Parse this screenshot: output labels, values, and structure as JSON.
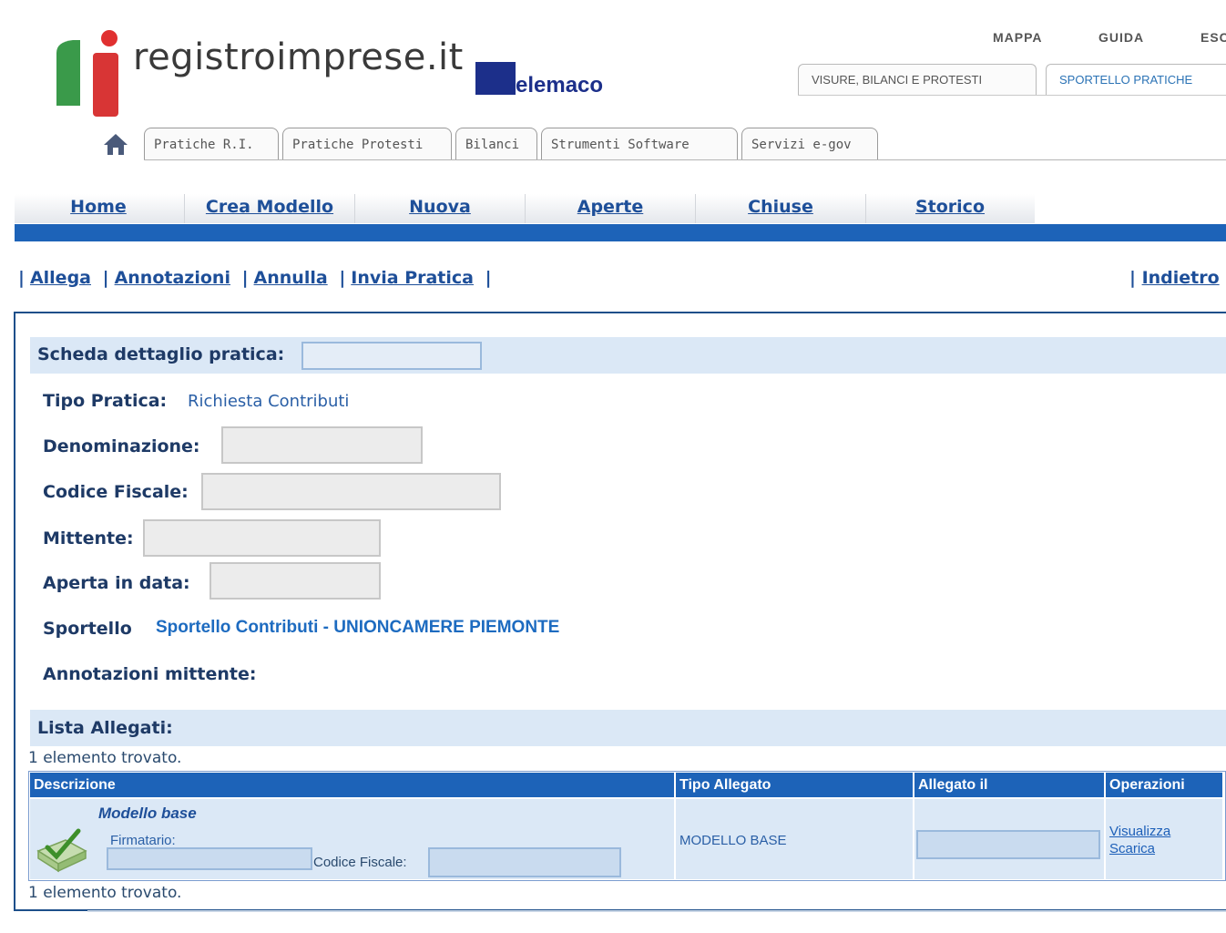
{
  "header": {
    "logo_text": "registroimprese.it",
    "telemaco_text": "elemaco",
    "top_links": [
      "MAPPA",
      "GUIDA",
      "ESCI"
    ],
    "main_tabs": [
      "VISURE, BILANCI E PROTESTI",
      "SPORTELLO PRATICHE"
    ],
    "sub_tabs": [
      "Pratiche R.I.",
      "Pratiche Protesti",
      "Bilanci",
      "Strumenti Software",
      "Servizi e-gov"
    ]
  },
  "nav": {
    "items": [
      "Home",
      "Crea Modello",
      "Nuova",
      "Aperte",
      "Chiuse",
      "Storico"
    ]
  },
  "actions": {
    "items": [
      "Allega",
      "Annotazioni",
      "Annulla",
      "Invia Pratica"
    ],
    "back": "Indietro"
  },
  "detail": {
    "title": "Scheda dettaglio pratica:",
    "tipo_label": "Tipo Pratica:",
    "tipo_value": "Richiesta Contributi",
    "denominazione_label": "Denominazione:",
    "codice_fiscale_label": "Codice Fiscale:",
    "mittente_label": "Mittente:",
    "aperta_label": "Aperta in data:",
    "sportello_label": "Sportello",
    "sportello_value": "Sportello Contributi  - UNIONCAMERE PIEMONTE",
    "annotazioni_label": "Annotazioni mittente:"
  },
  "allegati": {
    "title": "Lista Allegati:",
    "count_text": "1 elemento trovato.",
    "columns": [
      "Descrizione",
      "Tipo Allegato",
      "Allegato il",
      "Operazioni"
    ],
    "rows": [
      {
        "name": "Modello base",
        "firmatario_label": "Firmatario:",
        "codice_fiscale_label": "Codice Fiscale:",
        "tipo": "MODELLO BASE",
        "ops": [
          "Visualizza",
          "Scarica"
        ]
      }
    ]
  },
  "colors": {
    "accent": "#1d63b8",
    "band": "#dbe8f6",
    "link": "#1e4f99"
  }
}
